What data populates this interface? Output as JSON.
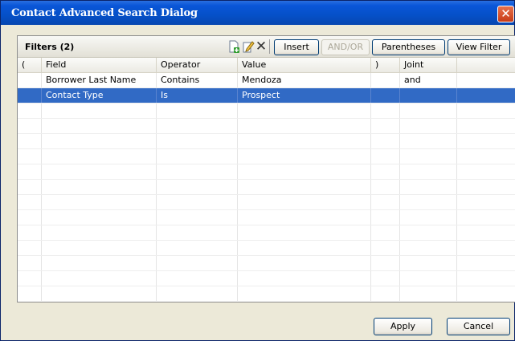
{
  "window": {
    "title": "Contact Advanced Search Dialog",
    "close_glyph": "✕"
  },
  "toolbar": {
    "filters_label": "Filters (2)",
    "icons": [
      "new-icon",
      "edit-icon",
      "delete-icon"
    ],
    "delete_glyph": "✕",
    "buttons": {
      "insert": "Insert",
      "and_or": "AND/OR",
      "parentheses": "Parentheses",
      "view_filter": "View Filter"
    }
  },
  "table": {
    "columns": [
      "(",
      "Field",
      "Operator",
      "Value",
      ")",
      "Joint",
      ""
    ],
    "rows": [
      {
        "open": "",
        "field": "Borrower Last Name",
        "operator": "Contains",
        "value": "Mendoza",
        "close": "",
        "joint": "and",
        "selected": false
      },
      {
        "open": "",
        "field": "Contact Type",
        "operator": "Is",
        "value": "Prospect",
        "close": "",
        "joint": "",
        "selected": true
      }
    ]
  },
  "footer": {
    "apply": "Apply",
    "cancel": "Cancel"
  },
  "colors": {
    "selection": "#316ac5",
    "titlebar": "#0a56d8",
    "close_button": "#c73b16"
  }
}
